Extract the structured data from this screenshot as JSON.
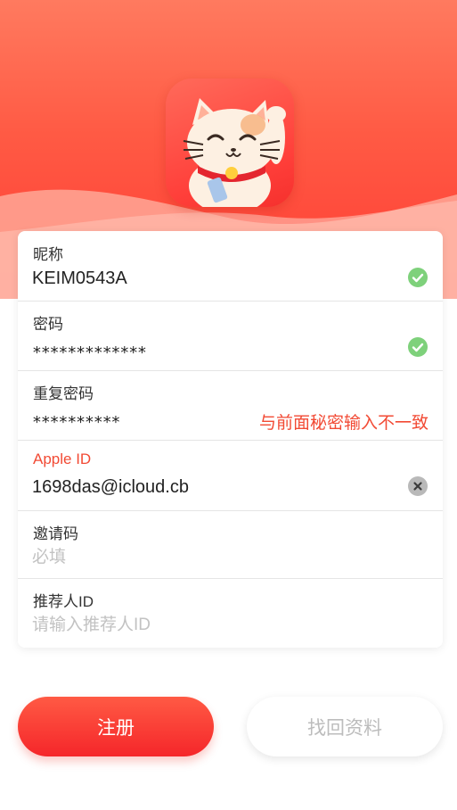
{
  "form": {
    "nickname": {
      "label": "昵称",
      "value": "KEIM0543A",
      "status_icon": "check-circle-icon"
    },
    "password": {
      "label": "密码",
      "value": "*************",
      "status_icon": "check-circle-icon"
    },
    "repeat_password": {
      "label": "重复密码",
      "value": "**********",
      "error": "与前面秘密输入不一致"
    },
    "apple_id": {
      "label": "Apple ID",
      "value": "1698das@icloud.cb",
      "status_icon": "clear-icon"
    },
    "invite_code": {
      "label": "邀请码",
      "placeholder": "必填"
    },
    "referrer_id": {
      "label": "推荐人ID",
      "placeholder": "请输入推荐人ID"
    }
  },
  "buttons": {
    "register": "注册",
    "recover": "找回资料"
  },
  "colors": {
    "accent": "#f5302d",
    "error": "#f24a34",
    "success": "#7ed17b"
  }
}
